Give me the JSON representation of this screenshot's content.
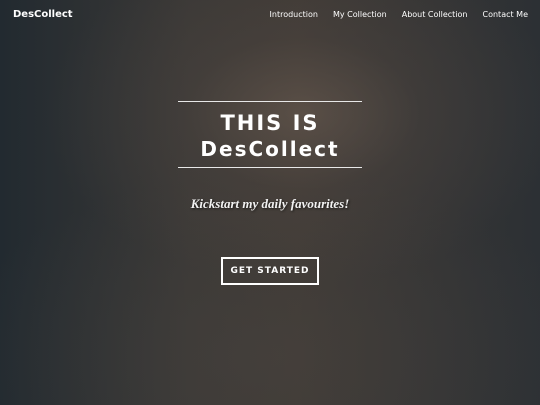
{
  "navbar": {
    "brand": "DesCollect",
    "links": [
      {
        "label": "Introduction"
      },
      {
        "label": "My Collection"
      },
      {
        "label": "About Collection"
      },
      {
        "label": "Contact Me"
      }
    ]
  },
  "hero": {
    "line1": "THIS IS",
    "line2": "DesCollect",
    "tagline": "Kickstart my daily favourites!",
    "cta_label": "GET STARTED"
  },
  "colors": {
    "text": "#ffffff",
    "background": "#35322f",
    "rule": "#e8e8e8"
  }
}
